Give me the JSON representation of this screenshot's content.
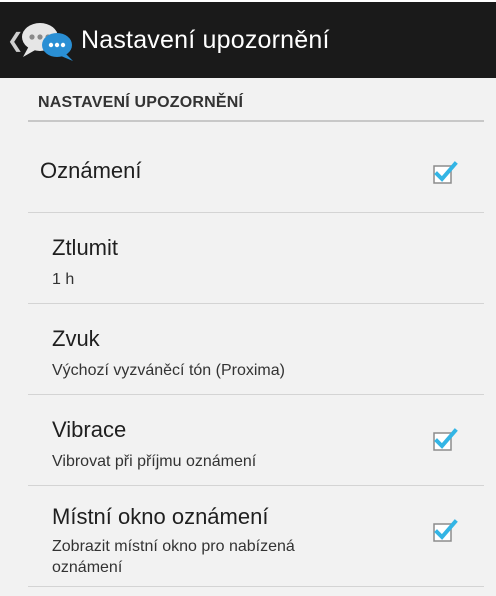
{
  "actionbar": {
    "title": "Nastavení upozornění",
    "up_icon": "chevron-left-icon",
    "app_icon": "chat-bubbles-icon"
  },
  "section": {
    "header": "NASTAVENÍ UPOZORNĚNÍ"
  },
  "prefs": [
    {
      "title": "Oznámení",
      "summary": "",
      "checked": true
    },
    {
      "title": "Ztlumit",
      "summary": "1 h"
    },
    {
      "title": "Zvuk",
      "summary": "Výchozí vyzváněcí tón (Proxima)"
    },
    {
      "title": "Vibrace",
      "summary": "Vibrovat při příjmu oznámení",
      "checked": true
    },
    {
      "title": "Místní okno oznámení",
      "summary_line1": "Zobrazit místní okno pro nabízená",
      "summary_line2": "oznámení",
      "checked": true
    }
  ],
  "colors": {
    "accent": "#33b5e5",
    "actionbar": "#1a1a1a",
    "background": "#f2f2f2"
  }
}
